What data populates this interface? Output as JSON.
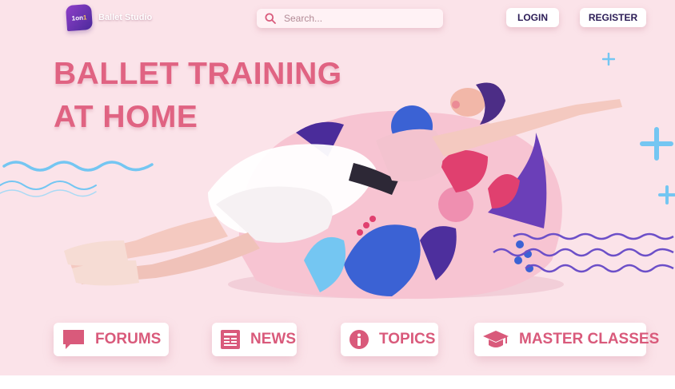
{
  "header": {
    "logo_badge_a": "1on",
    "logo_badge_b": "1",
    "brand_name": "Ballet Studio",
    "search_placeholder": "Search...",
    "login_label": "LOGIN",
    "register_label": "REGISTER"
  },
  "hero": {
    "title_line1": "BALLET TRAINING",
    "title_line2": "AT HOME"
  },
  "nav": {
    "forums_label": "FORUMS",
    "news_label": "NEWS",
    "topics_label": "TOPICS",
    "master_label": "MASTER CLASSES"
  },
  "colors": {
    "background": "#fbe3e9",
    "title_pink": "#e06382",
    "nav_label": "#d95a7b",
    "nav_dark": "#2b1c56",
    "accent_blue": "#74c6f2",
    "accent_purple": "#6c4fc8"
  },
  "icons": [
    "search-icon",
    "chat-icon",
    "newspaper-icon",
    "info-icon",
    "graduation-cap-icon",
    "plus-icon",
    "wave-icon"
  ]
}
